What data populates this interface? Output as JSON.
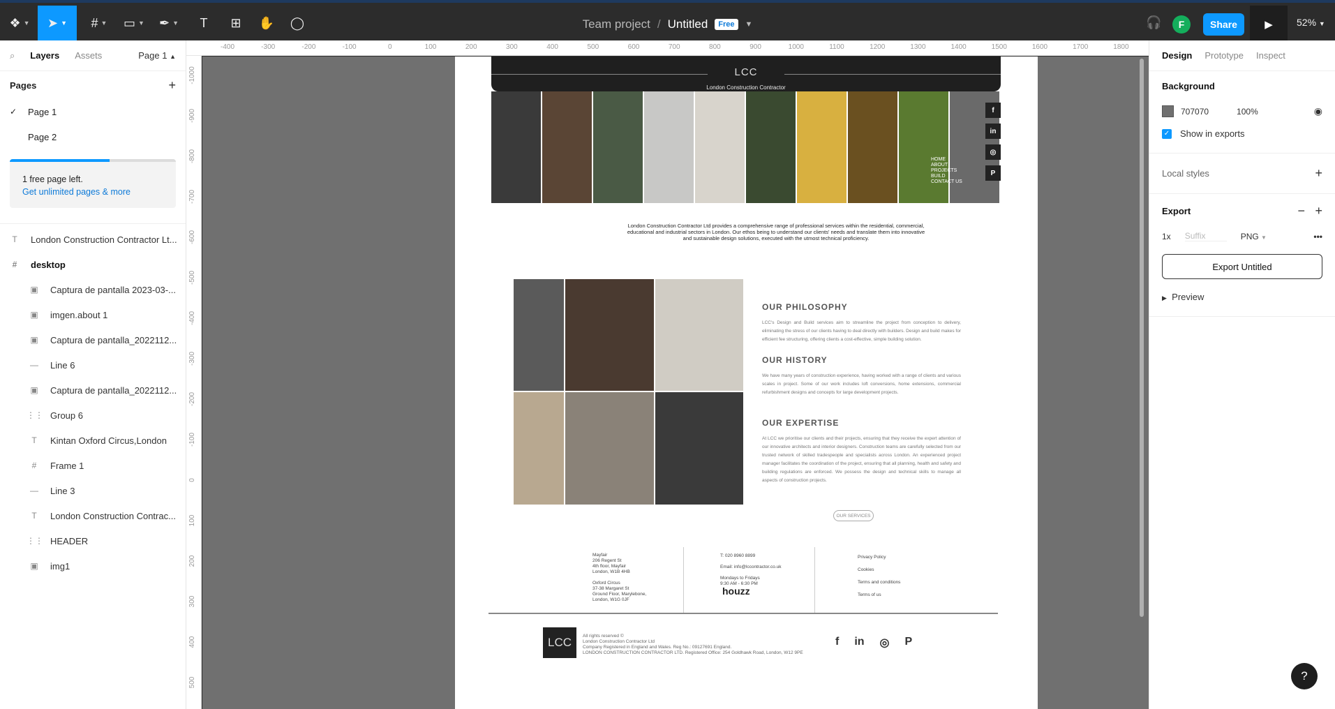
{
  "toolbar": {
    "menu_icon": "figma-menu-icon",
    "tools": [
      "move-tool",
      "frame-tool",
      "shape-tool",
      "pen-tool",
      "text-tool",
      "resources-tool",
      "hand-tool",
      "comment-tool"
    ],
    "text_tool_glyph": "T"
  },
  "title": {
    "team": "Team project",
    "separator": "/",
    "file": "Untitled",
    "badge": "Free"
  },
  "header_right": {
    "avatar_letter": "F",
    "share_label": "Share",
    "zoom": "52%"
  },
  "left_panel": {
    "tabs": {
      "layers": "Layers",
      "assets": "Assets",
      "page_select": "Page 1"
    },
    "pages_heading": "Pages",
    "pages": [
      {
        "label": "Page 1",
        "selected": true
      },
      {
        "label": "Page 2",
        "selected": false
      }
    ],
    "upgrade": {
      "text": "1 free page left.",
      "link": "Get unlimited pages & more",
      "progress": 0.6
    },
    "layers": [
      {
        "label": "London Construction Contractor Lt...",
        "icon": "text-icon",
        "level": 0
      },
      {
        "label": "desktop",
        "icon": "frame-icon",
        "level": 0,
        "frame": true
      },
      {
        "label": "Captura de pantalla 2023-03-...",
        "icon": "image-icon",
        "level": 1
      },
      {
        "label": "imgen.about 1",
        "icon": "image-icon",
        "level": 1
      },
      {
        "label": "Captura de pantalla_2022112...",
        "icon": "image-icon",
        "level": 1
      },
      {
        "label": "Line 6",
        "icon": "line-icon",
        "level": 1
      },
      {
        "label": "Captura de pantalla_2022112...",
        "icon": "image-icon",
        "level": 1
      },
      {
        "label": "Group 6",
        "icon": "group-icon",
        "level": 1
      },
      {
        "label": "Kintan Oxford Circus,London",
        "icon": "text-icon",
        "level": 1
      },
      {
        "label": "Frame 1",
        "icon": "frame-icon",
        "level": 1
      },
      {
        "label": "Line 3",
        "icon": "line-icon",
        "level": 1
      },
      {
        "label": "London Construction Contrac...",
        "icon": "text-icon",
        "level": 1
      },
      {
        "label": "HEADER",
        "icon": "group-icon",
        "level": 1
      },
      {
        "label": "img1",
        "icon": "image-icon",
        "level": 1
      }
    ]
  },
  "rulers": {
    "x": [
      "-400",
      "-300",
      "-200",
      "-100",
      "0",
      "100",
      "200",
      "300",
      "400",
      "500",
      "600",
      "700",
      "800",
      "900",
      "1000",
      "1100",
      "1200",
      "1300",
      "1400",
      "1500",
      "1600",
      "1700",
      "1800"
    ],
    "y": [
      "-1000",
      "-900",
      "-800",
      "-700",
      "-600",
      "-500",
      "-400",
      "-300",
      "-200",
      "-100",
      "0",
      "100",
      "200",
      "300",
      "400",
      "500"
    ]
  },
  "design": {
    "header": {
      "logo": "LCC",
      "subtitle": "London Construction Contractor"
    },
    "strip_colors": [
      "#3a3a3a",
      "#5a4535",
      "#4a5a45",
      "#c8c8c6",
      "#d8d4cc",
      "#3a4a30",
      "#d8b040",
      "#6a5020",
      "#5a7a30",
      "#6a6a6a"
    ],
    "side_socials": [
      "f",
      "in",
      "◎",
      "P"
    ],
    "mini_nav": [
      "HOME",
      "ABOUT",
      "PROJECTS",
      "BUILD",
      "CONTACT US"
    ],
    "intro": "London Construction Contractor Ltd provides a comprehensive range of professional services within the residential, commercial, educational and industrial sectors in London. Our ethos being to understand our clients' needs and translate them into innovative and sustainable design solutions, executed with the utmost technical proficiency.",
    "collage_colors": [
      "#5a5a5a",
      "#4a3a30",
      "#d0ccc4",
      "#b8a890",
      "#8a8278",
      "#3a3a3a"
    ],
    "sections": [
      {
        "title": "OUR PHILOSOPHY",
        "text": "LCC's Design and Build services aim to streamline the project from conception to delivery, eliminating the stress of our clients having to deal directly with builders. Design and build makes for efficient fee structuring, offering clients a cost-effective, simple building solution."
      },
      {
        "title": "OUR HISTORY",
        "text": "We have many years of construction experience, having worked with a range of clients and various scales in project. Some of our work includes loft conversions, home extensions, commercial refurbishment designs and concepts for large development projects."
      },
      {
        "title": "OUR EXPERTISE",
        "text": "At LCC we prioritise our clients and their projects, ensuring that they receive the expert attention of our innovative architects and interior designers. Construction teams are carefully selected from our trusted network of skilled tradespeople and specialists across London. An experienced project manager facilitates the coordination of the project, ensuring that all planning, health and safety and building regulations are enforced. We possess the design and technical skills to manage all aspects of construction projects."
      }
    ],
    "services_button": "OUR SERVICES",
    "footer": {
      "address1": [
        "Mayfair",
        "206 Regent St",
        "4th floor, Mayfair",
        "London, W1B 4HB"
      ],
      "address2": [
        "Oxford Circus",
        "37-38 Margaret St",
        "Ground Floor, Marylebone,",
        "London, W1G 0JF"
      ],
      "phone": "T: 020 8960 8899",
      "email": "Email: info@lccontractor.co.uk",
      "hours": [
        "Mondays to Fridays",
        "9:30 AM - 6:30 PM"
      ],
      "houzz": "houzz",
      "links": [
        "Privacy Policy",
        "Cookies",
        "Terms and conditions",
        "Terms of us"
      ],
      "logo": "LCC",
      "legal": [
        "All rights reserved ©",
        "London Construction Contractor Ltd",
        "Company Registered in England and Wales. Reg No.: 09127691 England.",
        "LONDON CONSTRUCTION CONTRACTOR LTD. Registered Office: 254 Goldhawk Road, London, W12 9PE"
      ],
      "socials": [
        "f",
        "in",
        "◎",
        "P"
      ]
    }
  },
  "right_panel": {
    "tabs": {
      "design": "Design",
      "prototype": "Prototype",
      "inspect": "Inspect"
    },
    "background": {
      "heading": "Background",
      "hex": "707070",
      "opacity": "100%",
      "show_in_exports": "Show in exports"
    },
    "local_styles": "Local styles",
    "export": {
      "heading": "Export",
      "scale": "1x",
      "suffix_placeholder": "Suffix",
      "format": "PNG",
      "button": "Export Untitled",
      "preview": "Preview"
    }
  },
  "help": "?"
}
